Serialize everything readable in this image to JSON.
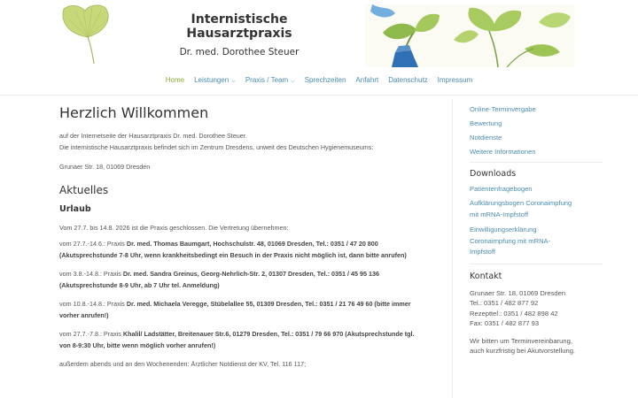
{
  "header": {
    "title": "Internistische Hausarztpraxis",
    "subtitle": "Dr. med. Dorothee Steuer"
  },
  "nav": {
    "items": [
      {
        "label": "Home",
        "active": true,
        "dropdown": false
      },
      {
        "label": "Leistungen",
        "active": false,
        "dropdown": true
      },
      {
        "label": "Praxis / Team",
        "active": false,
        "dropdown": true
      },
      {
        "label": "Sprechzeiten",
        "active": false,
        "dropdown": false
      },
      {
        "label": "Anfahrt",
        "active": false,
        "dropdown": false
      },
      {
        "label": "Datenschutz",
        "active": false,
        "dropdown": false
      },
      {
        "label": "Impressum",
        "active": false,
        "dropdown": false
      }
    ],
    "caret_icon": "chevron-down-icon"
  },
  "main": {
    "welcome_heading": "Herzlich Willkommen",
    "intro_line1": "auf der Internetseite der Hausarztpraxis Dr. med. Dorothee Steuer.",
    "intro_line2": "Die internistische Hausarztpraxis befindet sich im Zentrum Dresdens, unweit des Deutschen Hygienemuseums:",
    "address": "Grunaer Str. 18, 01069 Dresden",
    "news_heading": "Aktuelles",
    "vacation_heading": "Urlaub",
    "vacation_text": "Vom 27.7. bis 14.8. 2026 ist die Praxis geschlossen. Die Vertretung übernehmen:",
    "replacements": [
      {
        "prefix": "vom 27.7.-14.6.: Praxis ",
        "bold_line1": "Dr. med. Thomas Baumgart, Hochschulstr. 48, 01069 Dresden, Tel.: 0351 / 47 20 800",
        "bold_line2": "(Akutsprechstunde 7-8 Uhr, wenn krankheitsbedingt ein Besuch in der Praxis nicht möglich ist, dann bitte anrufen)"
      },
      {
        "prefix": "vom 3.8.-14.8.: Praxis ",
        "bold_line1": "Dr. med. Sandra Greinus, Georg-Nehrlich-Str. 2, 01307 Dresden, Tel.: 0351 / 45 95 136",
        "bold_line2": "(Akutsprechstunde 8-9 Uhr, ab 7 Uhr tel. Anmeldung)"
      },
      {
        "prefix": "vom 10.8.-14.8.: Praxis ",
        "bold_line1": "Dr. med. Michaela Veregge, Stübelallee 55, 01309 Dresden, Tel.: 0351 / 21 76 49 60 (bitte immer",
        "bold_line2": "vorher anrufen!)"
      },
      {
        "prefix": "vom 27.7.-7.8.: Praxis ",
        "bold_line1": "Khalil/ Ladstätter, Breitenauer Str.6, 01279 Dresden, Tel.: 0351 / 79 66 970  (Akutsprechstunde tgl.",
        "bold_line2": "von 8-9:30 Uhr, bitte wenn möglich vorher anrufen!)"
      }
    ],
    "closing": "außerdem abends und an den Wochenenden: Ärztlicher Notdienst der KV, Tel. 116 117;"
  },
  "sidebar": {
    "links": [
      "Online-Terminvergabe",
      "Bewertung",
      "Notdienste",
      "Weitere Informationen"
    ],
    "downloads_heading": "Downloads",
    "downloads": [
      {
        "line1": "Patientenfragebogen",
        "line2": ""
      },
      {
        "line1": "Aufklärungsbogen Coronaimpfung",
        "line2": "mit mRNA-Impfstoff"
      },
      {
        "line1": "Einwilligungserklärung",
        "line2": "Coronaimpfung mit mRNA-",
        "line3": "Impfstoff"
      }
    ],
    "contact_heading": "Kontakt",
    "contact": {
      "address": "Grunaer Str. 18, 01069 Dresden",
      "tel": "Tel.: 0351 / 482 877 92",
      "rezepttel": "Rezepttel.: 0351 / 482 898 42",
      "fax": "Fax: 0351 / 482 877 93",
      "note_line1": "Wir bitten um Terminvereinbarung,",
      "note_line2": "auch kurzfristig bei Akutvorstellung."
    }
  },
  "colors": {
    "link": "#4a8bb0",
    "active_nav": "#8cab3c",
    "heading": "#333333",
    "body_text": "#555555"
  }
}
